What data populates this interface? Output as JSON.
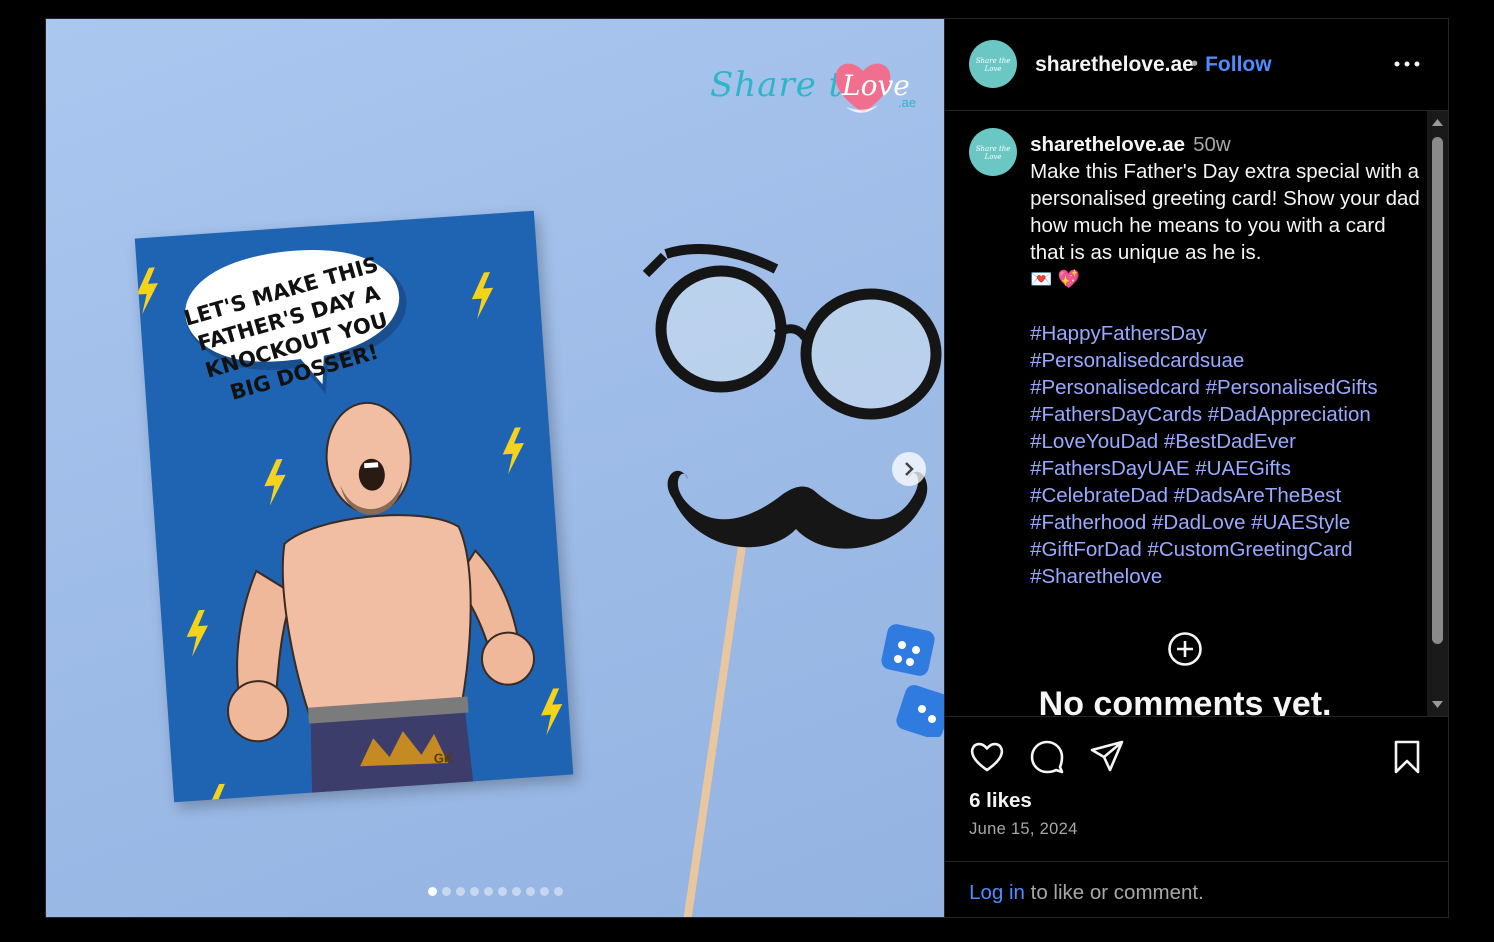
{
  "post": {
    "username": "sharethelove.ae",
    "separator": "•",
    "follow_label": "Follow",
    "avatar_text": "Share the Love",
    "more_icon": "more-horizontal-icon"
  },
  "media": {
    "brand_text_1": "Share the",
    "brand_text_2": "Love",
    "brand_suffix": ".ae",
    "card_speech": "LET'S MAKE THIS FATHER'S DAY A KNOCKOUT YOU BIG DOSSER!",
    "card_initials": "GK",
    "carousel_total": 10,
    "carousel_active_index": 0,
    "next_icon": "chevron-right-icon",
    "colors": {
      "card_blue": "#1f63b3",
      "bolt_yellow": "#f5d21c",
      "background": "#a9c7ef"
    }
  },
  "caption": {
    "username": "sharethelove.ae",
    "time": "50w",
    "text": "Make this Father's Day extra special with a personalised greeting card! Show your dad how much he means to you with a card that is as unique as he is.",
    "emojis": "💌 💖",
    "hashtag_lines": [
      "#HappyFathersDay",
      "#Personalisedcardsuae",
      "#Personalisedcard #PersonalisedGifts",
      "#FathersDayCards #DadAppreciation",
      "#LoveYouDad #BestDadEver",
      "#FathersDayUAE #UAEGifts",
      "#CelebrateDad #DadsAreTheBest",
      "#Fatherhood #DadLove #UAEStyle",
      "#GiftForDad #CustomGreetingCard",
      "#Sharethelove"
    ]
  },
  "comments": {
    "add_icon": "add-circle-icon",
    "empty_title": "No comments yet."
  },
  "actions": {
    "like_icon": "heart-icon",
    "comment_icon": "comment-icon",
    "share_icon": "send-icon",
    "save_icon": "bookmark-icon"
  },
  "likes_text": "6 likes",
  "date_text": "June 15, 2024",
  "login": {
    "link_text": "Log in",
    "suffix_text": " to like or comment."
  },
  "colors": {
    "link": "#4f8cff",
    "hashtag": "#9aa9ff",
    "muted": "#a8a8a8",
    "border": "#262626"
  }
}
